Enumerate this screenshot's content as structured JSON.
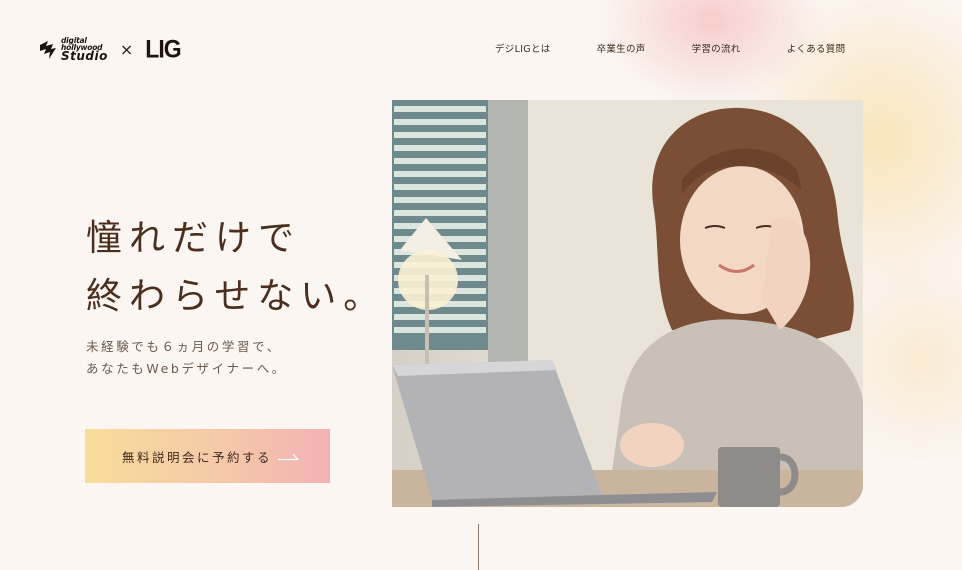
{
  "header": {
    "logo_digital": "digital",
    "logo_hollywood": "hollywood",
    "logo_studio": "Studio",
    "logo_cross": "×",
    "logo_lig": "LIG",
    "nav": [
      {
        "label": "デジLIGとは"
      },
      {
        "label": "卒業生の声"
      },
      {
        "label": "学習の流れ"
      },
      {
        "label": "よくある質問"
      }
    ]
  },
  "hero": {
    "headline_line1": "憧れだけで",
    "headline_line2": "終わらせない。",
    "sub_line1": "未経験でも６ヵ月の学習で、",
    "sub_line2": "あなたもWebデザイナーへ。",
    "cta_label": "無料説明会に予約する",
    "photo_icon": "woman-with-laptop-photo"
  },
  "colors": {
    "background": "#fbf6f2",
    "text": "#4a2f1f",
    "cta_gradient_start": "#f7dc9b",
    "cta_gradient_end": "#f1b2b4"
  }
}
